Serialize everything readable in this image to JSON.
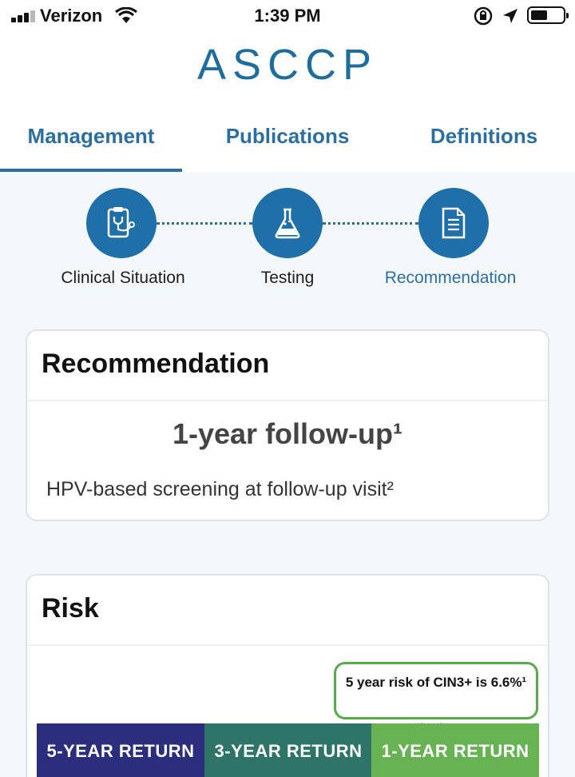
{
  "status_bar": {
    "carrier": "Verizon",
    "time": "1:39 PM",
    "signal_bars_active": 3,
    "icons": [
      "signal-icon",
      "wifi-icon",
      "rotation-lock-icon",
      "location-arrow-icon",
      "battery-icon"
    ]
  },
  "header": {
    "logo": "ASCCP"
  },
  "tabs": [
    {
      "label": "Management",
      "active": true
    },
    {
      "label": "Publications",
      "active": false
    },
    {
      "label": "Definitions",
      "active": false
    }
  ],
  "stepper": {
    "steps": [
      {
        "label": "Clinical Situation",
        "icon": "clipboard-stethoscope-icon",
        "active": false
      },
      {
        "label": "Testing",
        "icon": "flask-icon",
        "active": false
      },
      {
        "label": "Recommendation",
        "icon": "document-icon",
        "active": true
      }
    ]
  },
  "recommendation": {
    "title": "Recommendation",
    "headline": "1-year follow-up¹",
    "detail": "HPV-based screening at follow-up visit²"
  },
  "risk": {
    "title": "Risk",
    "callout": "5 year risk of CIN3+ is 6.6%¹",
    "bars": [
      {
        "label": "5-YEAR RETURN",
        "color": "#2a2e7c"
      },
      {
        "label": "3-YEAR RETURN",
        "color": "#2f7468"
      },
      {
        "label": "1-YEAR RETURN",
        "color": "#67b353"
      }
    ]
  },
  "colors": {
    "brand_blue": "#1f6fa8",
    "tab_blue": "#2b6fa1",
    "callout_green": "#5aa94c"
  }
}
